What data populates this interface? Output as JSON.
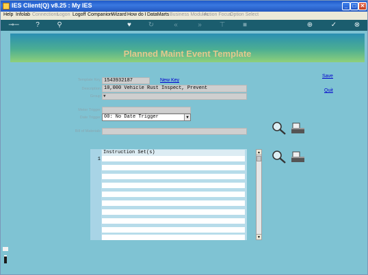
{
  "window": {
    "title": "IES Client(Q) v8.25 : My IES"
  },
  "menu": {
    "items": [
      {
        "label": "Help",
        "enabled": true
      },
      {
        "label": "Infolab",
        "enabled": true
      },
      {
        "label": "Connections",
        "enabled": false
      },
      {
        "label": "Logon",
        "enabled": false
      },
      {
        "label": "Logoff",
        "enabled": true
      },
      {
        "label": "Companion",
        "enabled": true
      },
      {
        "label": "Wizard",
        "enabled": true
      },
      {
        "label": "How do I",
        "enabled": true
      },
      {
        "label": "DataMarts",
        "enabled": true
      },
      {
        "label": "Business Modules",
        "enabled": false
      },
      {
        "label": "Action Focus",
        "enabled": false
      },
      {
        "label": "Option Select",
        "enabled": false
      }
    ]
  },
  "banner": {
    "title": "Planned Maint Event Template"
  },
  "form": {
    "template_key_label": "Template Key",
    "template_key_value": "1543932187",
    "new_key_link": "New Key",
    "description_label": "Description",
    "description_value": "10,000 Vehicle Rust Inspect, Prevent",
    "group_label": "Group",
    "group_value": "",
    "meter_trigger_label": "Meter Trigger",
    "meter_trigger_value": "",
    "date_trigger_label": "Date Trigger",
    "date_trigger_value": "00: No Date Trigger",
    "bill_of_materials_label": "Bill of Materials",
    "bill_of_materials_value": ""
  },
  "actions": {
    "save": "Save",
    "quit": "Quit"
  },
  "instructions": {
    "header": "Instruction Set(s)",
    "rows": [
      {
        "num": "1",
        "text": ""
      }
    ]
  }
}
